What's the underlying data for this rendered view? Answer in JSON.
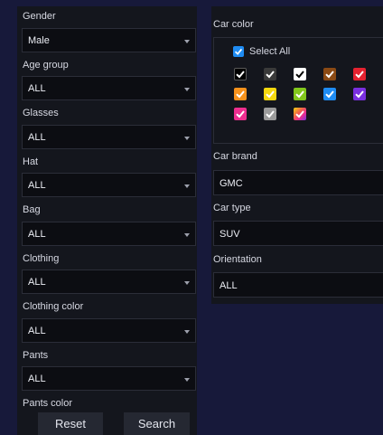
{
  "left": {
    "gender": {
      "label": "Gender",
      "value": "Male"
    },
    "age_group": {
      "label": "Age group",
      "value": "ALL"
    },
    "glasses": {
      "label": "Glasses",
      "value": "ALL"
    },
    "hat": {
      "label": "Hat",
      "value": "ALL"
    },
    "bag": {
      "label": "Bag",
      "value": "ALL"
    },
    "clothing": {
      "label": "Clothing",
      "value": "ALL"
    },
    "clothing_color": {
      "label": "Clothing color",
      "value": "ALL"
    },
    "pants": {
      "label": "Pants",
      "value": "ALL"
    },
    "pants_color": {
      "label": "Pants color"
    },
    "reset_label": "Reset",
    "search_label": "Search"
  },
  "right": {
    "car_color_label": "Car color",
    "select_all_label": "Select All",
    "swatches": [
      {
        "name": "black",
        "color": "#000000",
        "checked": true
      },
      {
        "name": "dark-gray",
        "color": "#3a3a3a",
        "checked": true
      },
      {
        "name": "white",
        "color": "#ffffff",
        "checked": true
      },
      {
        "name": "brown",
        "color": "#8b4a14",
        "checked": true
      },
      {
        "name": "red",
        "color": "#e52230",
        "checked": true
      },
      {
        "name": "orange",
        "color": "#f7921c",
        "checked": true
      },
      {
        "name": "yellow",
        "color": "#f5d80f",
        "checked": true
      },
      {
        "name": "green",
        "color": "#82c71c",
        "checked": true
      },
      {
        "name": "blue",
        "color": "#1f8cf3",
        "checked": true
      },
      {
        "name": "purple",
        "color": "#7a2fe0",
        "checked": true
      },
      {
        "name": "pink",
        "color": "#ee2e8f",
        "checked": true
      },
      {
        "name": "silver",
        "color": "#9b9b9b",
        "checked": true
      },
      {
        "name": "multicolor",
        "color": "#f0614a",
        "checked": true
      }
    ],
    "car_brand": {
      "label": "Car brand",
      "value": "GMC"
    },
    "car_type": {
      "label": "Car type",
      "value": "SUV"
    },
    "orientation": {
      "label": "Orientation",
      "value": "ALL"
    }
  },
  "colors": {
    "page_bg": "#17193a",
    "panel_bg": "#14161d",
    "select_all_blue": "#1f8cf3"
  }
}
